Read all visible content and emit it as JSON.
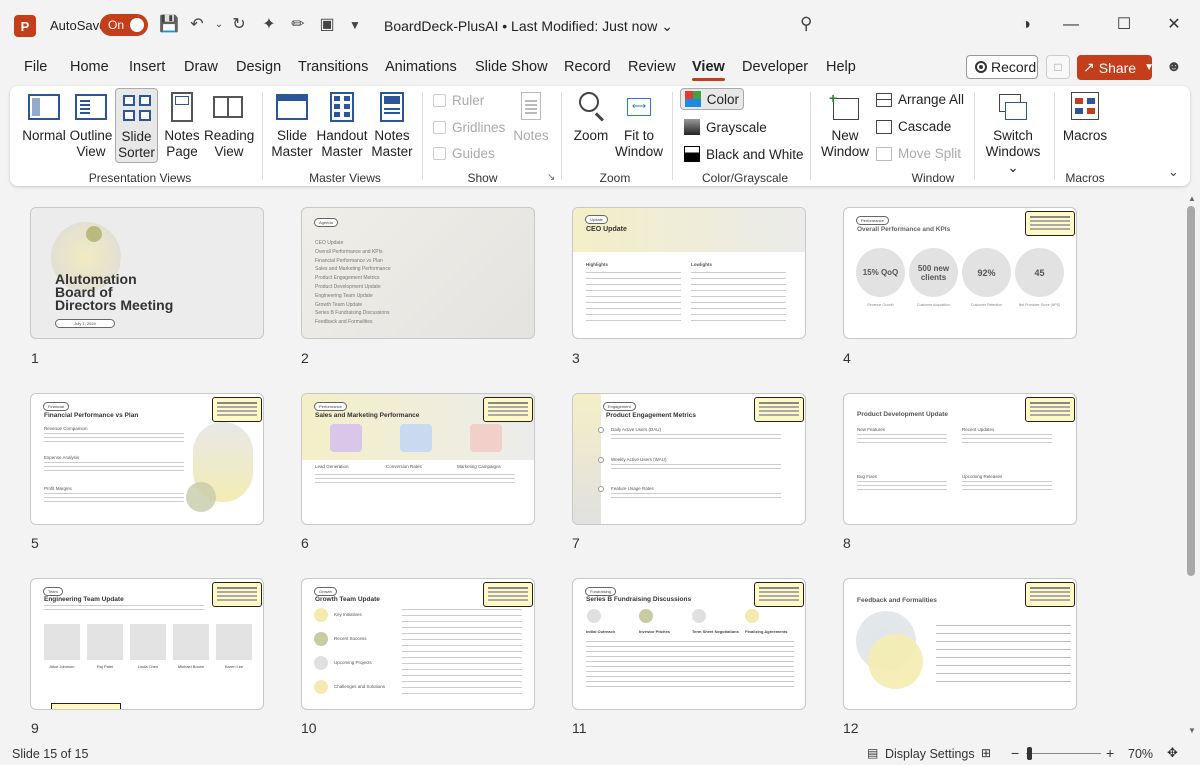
{
  "titlebar": {
    "app_logo": "P",
    "autosave_label": "AutoSave",
    "autosave_state": "On",
    "doc_title": "BoardDeck-PlusAI  •  Last Modified: Just now  ⌄"
  },
  "tabs": [
    "File",
    "Home",
    "Insert",
    "Draw",
    "Design",
    "Transitions",
    "Animations",
    "Slide Show",
    "Record",
    "Review",
    "View",
    "Developer",
    "Help"
  ],
  "active_tab": "View",
  "actions": {
    "record": "Record",
    "share": "Share"
  },
  "ribbon": {
    "presentation_views": {
      "label": "Presentation Views",
      "normal": "Normal",
      "outline_view_1": "Outline",
      "outline_view_2": "View",
      "slide_sorter_1": "Slide",
      "slide_sorter_2": "Sorter",
      "notes_page_1": "Notes",
      "notes_page_2": "Page",
      "reading_view_1": "Reading",
      "reading_view_2": "View"
    },
    "master_views": {
      "label": "Master Views",
      "slide_master_1": "Slide",
      "slide_master_2": "Master",
      "handout_master_1": "Handout",
      "handout_master_2": "Master",
      "notes_master_1": "Notes",
      "notes_master_2": "Master"
    },
    "show": {
      "label": "Show",
      "ruler": "Ruler",
      "gridlines": "Gridlines",
      "guides": "Guides",
      "notes": "Notes"
    },
    "zoom": {
      "label": "Zoom",
      "zoom": "Zoom",
      "fit_1": "Fit to",
      "fit_2": "Window"
    },
    "color_grayscale": {
      "label": "Color/Grayscale",
      "color": "Color",
      "grayscale": "Grayscale",
      "bw": "Black and White"
    },
    "window": {
      "label": "Window",
      "new_window_1": "New",
      "new_window_2": "Window",
      "arrange_all": "Arrange All",
      "cascade": "Cascade",
      "move_split": "Move Split",
      "switch_1": "Switch",
      "switch_2": "Windows ⌄"
    },
    "macros": {
      "label": "Macros",
      "macros": "Macros"
    }
  },
  "slides": [
    {
      "num": "1",
      "title": "Alutomation Board of Directors Meeting",
      "title_l1": "Alutomation",
      "title_l2": "Board of",
      "title_l3": "Directors Meeting",
      "date": "July 1, 2024"
    },
    {
      "num": "2",
      "tag": "Agenda",
      "items": [
        "CEO Update",
        "Overall Performance and KPIs",
        "Financial Performance vs Plan",
        "Sales and Marketing Performance",
        "Product Engagement Metrics",
        "Product Development Update",
        "Engineering Team Update",
        "Growth Team Update",
        "Series B Fundraising Discussions",
        "Feedback and Formalities"
      ]
    },
    {
      "num": "3",
      "tag": "Update",
      "title": "CEO Update",
      "col1": "Highlights",
      "col2": "Lowlights"
    },
    {
      "num": "4",
      "tag": "Performance",
      "title": "Overall Performance and KPIs",
      "kpis": [
        "15% QoQ",
        "500 new clients",
        "92%",
        "45"
      ],
      "kpi_labels": [
        "Revenue Growth",
        "Customer Acquisition",
        "Customer Retention",
        "Net Promoter Score (NPS)"
      ]
    },
    {
      "num": "5",
      "tag": "Financial",
      "title": "Financial Performance vs Plan",
      "sections": [
        "Revenue Comparison",
        "Expense Analysis",
        "Profit Margins"
      ]
    },
    {
      "num": "6",
      "tag": "Performance",
      "title": "Sales and Marketing Performance",
      "cols": [
        "Lead Generation",
        "Conversion Rates",
        "Marketing Campaigns"
      ]
    },
    {
      "num": "7",
      "tag": "Engagement",
      "title": "Product Engagement Metrics",
      "items": [
        "Daily Active Users (DAU)",
        "Weekly Active Users (WAU)",
        "Feature Usage Rates"
      ]
    },
    {
      "num": "8",
      "title": "Product Development Update",
      "sections": [
        "New Features",
        "Recent Updates",
        "Bug Fixes",
        "Upcoming Releases"
      ]
    },
    {
      "num": "9",
      "tag": "Team",
      "title": "Engineering Team Update",
      "people": [
        "Alice Johnson",
        "Raj Patel",
        "Linda Chen",
        "Michael Brown",
        "Karen Lee"
      ]
    },
    {
      "num": "10",
      "tag": "Growth",
      "title": "Growth Team Update",
      "rows": [
        "Key Initiatives",
        "Recent Success",
        "Upcoming Projects",
        "Challenges and Solutions"
      ]
    },
    {
      "num": "11",
      "tag": "Fundraising",
      "title": "Series B Fundraising Discussions",
      "cols": [
        "Initial Outreach",
        "Investor Pitches",
        "Term Sheet Negotiations",
        "Finalizing Agreements"
      ]
    },
    {
      "num": "12",
      "title": "Feedback and Formalities"
    }
  ],
  "statusbar": {
    "slide_info": "Slide 15 of 15",
    "display_settings": "Display Settings",
    "zoom": "70%"
  }
}
